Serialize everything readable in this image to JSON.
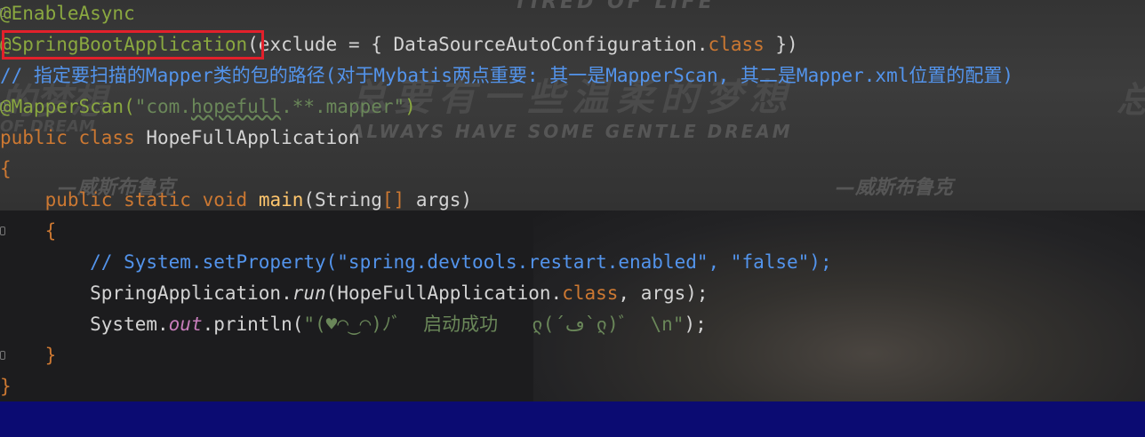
{
  "watermark": {
    "top_en": "TIRED OF LIFE",
    "left_zh": "的梦想",
    "center_zh": "总要有一些温柔的梦想",
    "right_zh": "总",
    "left_en": "OF DREAM",
    "center_en": "ALWAYS HAVE SOME GENTLE DREAM",
    "sign_left": "—威斯布鲁克",
    "sign_right": "—威斯布鲁克"
  },
  "code": {
    "l1_ann": "@EnableAsync",
    "l2_ann": "@SpringBootApplication",
    "l2_rest_a": "(exclude = { DataSourceAutoConfiguration.",
    "l2_kw": "class",
    "l2_rest_b": " })",
    "l3_comment": "// 指定要扫描的Mapper类的包的路径(对于Mybatis两点重要: 其一是MapperScan, 其二是Mapper.xml位置的配置)",
    "l4_ann": "@MapperScan(",
    "l4_str_a": "\"com.",
    "l4_str_b": "hopefull",
    "l4_str_c": ".**.mapper\"",
    "l4_close": ")",
    "l5_kw": "public class",
    "l5_name": " HopeFullApplication",
    "l6": "{",
    "l7_indent": "    ",
    "l7_kw": "public static void",
    "l7_space": " ",
    "l7_method": "main",
    "l7_rest_a": "(String",
    "l7_brackets": "[]",
    "l7_rest_b": " args)",
    "l8": "    {",
    "l9": "        // System.setProperty(\"spring.devtools.restart.enabled\", \"false\");",
    "l10_a": "        SpringApplication.",
    "l10_run": "run",
    "l10_b": "(HopeFullApplication.",
    "l10_kw": "class",
    "l10_c": ", args);",
    "l11_a": "        System.",
    "l11_out": "out",
    "l11_b": ".println(",
    "l11_str": "\"(♥◠‿◠)ﾉﾞ  启动成功   ლ(´ڡ`ლ)ﾞ  \\n\"",
    "l11_c": ");",
    "l12": "    }",
    "l13": "}"
  },
  "colors": {
    "annotation": "#8aa840",
    "keyword": "#cc7832",
    "string": "#6a8759",
    "comment": "#5394ec",
    "method": "#ffc66d",
    "field": "#c77dbb",
    "highlight_box": "#e2202b",
    "selection_bar": "#0b0b72"
  }
}
